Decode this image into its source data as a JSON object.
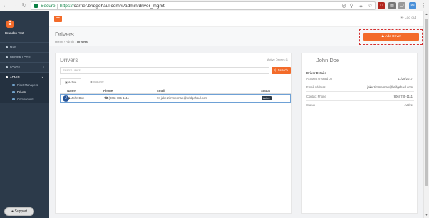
{
  "browser": {
    "secure_label": "Secure",
    "url_scheme": "https://",
    "url_rest": "carrier.bridgehaul.com/#/admin/driver_mgmt"
  },
  "sidebar": {
    "user_initial": "B",
    "user_name": "Brandon Test",
    "items": [
      {
        "label": "MAP"
      },
      {
        "label": "DRIVER LOGS"
      },
      {
        "label": "LOADS"
      },
      {
        "label": "ADMIN"
      }
    ],
    "sub_items": [
      {
        "label": "Fleet Managers"
      },
      {
        "label": "Drivers"
      },
      {
        "label": "Components"
      }
    ],
    "support_label": "Support"
  },
  "topbar": {
    "logout_label": "Log out"
  },
  "header": {
    "title": "Drivers",
    "breadcrumb": [
      "Home",
      "Admin",
      "Drivers"
    ],
    "add_driver_label": "Add Driver"
  },
  "drivers_panel": {
    "title": "Drivers",
    "active_count": "Active Drivers: 1",
    "search_placeholder": "Search users",
    "search_button": "Search",
    "tabs": [
      {
        "label": "Active"
      },
      {
        "label": "Inactive"
      }
    ],
    "columns": [
      "Name",
      "Phone",
      "Email",
      "Status"
    ],
    "rows": [
      {
        "initial": "J",
        "name": "John Doe",
        "phone": "(806) 785-1111",
        "email": "jake.zimmerman@bridgehaul.com",
        "status": "Active"
      }
    ]
  },
  "detail_panel": {
    "name": "John Doe",
    "section_label": "Driver Details",
    "fields": [
      {
        "label": "Account created on",
        "value": "11/28/2017"
      },
      {
        "label": "Email address",
        "value": "jake.zimmerman@bridgehaul.com"
      },
      {
        "label": "Contact Phone",
        "value": "(806) 785-1111"
      },
      {
        "label": "Status",
        "value": "Active"
      }
    ]
  },
  "colors": {
    "accent": "#f36b2a",
    "sidebar": "#2c3a4a",
    "highlight": "#d32f2f"
  }
}
